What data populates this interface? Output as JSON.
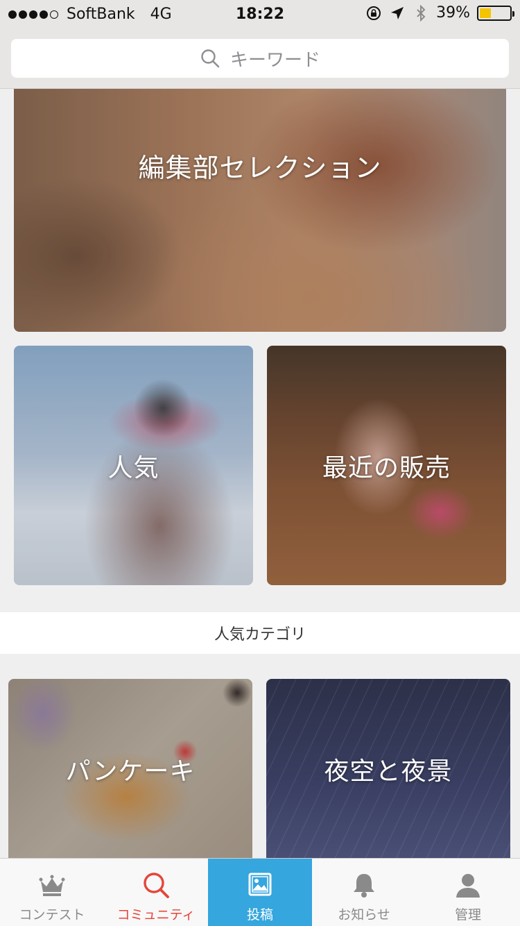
{
  "status_bar": {
    "carrier": "SoftBank",
    "network": "4G",
    "time": "18:22",
    "battery": "39%",
    "battery_level": 0.39
  },
  "search": {
    "placeholder": "キーワード"
  },
  "featured": {
    "editorial": "編集部セレクション",
    "popular": "人気",
    "recent_sales": "最近の販売"
  },
  "section": {
    "title": "人気カテゴリ"
  },
  "categories": [
    {
      "label": "パンケーキ"
    },
    {
      "label": "夜空と夜景"
    }
  ],
  "tabs": [
    {
      "label": "コンテスト",
      "icon": "crown-icon"
    },
    {
      "label": "コミュニティ",
      "icon": "search-icon"
    },
    {
      "label": "投稿",
      "icon": "photo-icon"
    },
    {
      "label": "お知らせ",
      "icon": "bell-icon"
    },
    {
      "label": "管理",
      "icon": "person-icon"
    }
  ],
  "colors": {
    "active_tab": "#e5453a",
    "post_tab_bg": "#35a6de",
    "battery": "#f5c400"
  }
}
